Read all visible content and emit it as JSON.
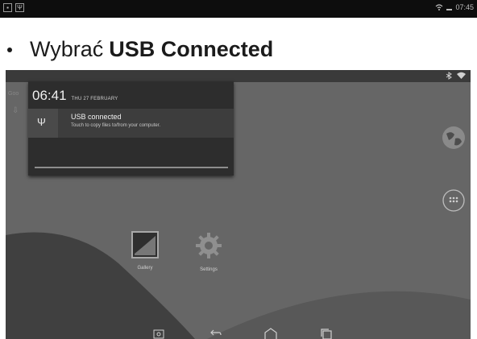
{
  "top_bar": {
    "time": "07:45",
    "left_icons": [
      "image-icon",
      "usb-icon"
    ],
    "right_icons": [
      "wifi-icon",
      "battery-icon"
    ]
  },
  "instruction": {
    "prefix": "Wybrać",
    "bold": "USB Connected"
  },
  "device": {
    "status_icons": [
      "bluetooth-icon",
      "wifi-icon"
    ],
    "notification_panel": {
      "time": "06:41",
      "date": "THU 27 FEBRUARY",
      "item": {
        "icon": "usb-icon",
        "title": "USB connected",
        "subtitle": "Touch to copy files to/from your computer."
      }
    },
    "left_ghost_label": "Goo",
    "desktop_icons": [
      {
        "label": "Gallery",
        "icon": "gallery-icon"
      },
      {
        "label": "Settings",
        "icon": "settings-icon"
      }
    ],
    "right_widgets": [
      "globe-icon",
      "apps-icon"
    ],
    "nav_buttons": [
      "screenshot-icon",
      "back-icon",
      "home-icon",
      "recents-icon"
    ]
  },
  "colors": {
    "page_bg": "#ffffff",
    "top_bar_bg": "#0d0d0d",
    "wallpaper_light": "#6a6a6a",
    "wallpaper_dark": "#3f3f3f",
    "panel_bg": "#2d2d2d",
    "panel_item_bg": "#3d3d3d"
  }
}
